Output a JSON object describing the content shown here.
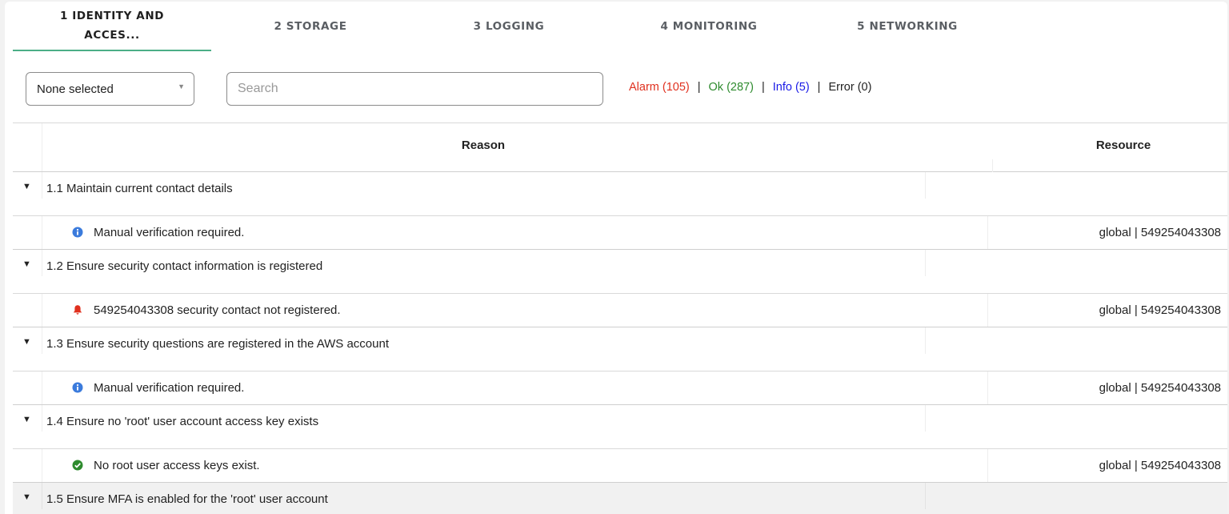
{
  "tabs": [
    {
      "label_line1": "1 IDENTITY AND",
      "label_line2": "ACCES..."
    },
    {
      "label": "2 STORAGE"
    },
    {
      "label": "3 LOGGING"
    },
    {
      "label": "4 MONITORING"
    },
    {
      "label": "5 NETWORKING"
    }
  ],
  "filter": {
    "selected": "None selected",
    "arrow": "▼"
  },
  "search": {
    "placeholder": "Search"
  },
  "counts": {
    "alarm": "Alarm (105)",
    "ok": "Ok (287)",
    "info": "Info (5)",
    "error": "Error (0)",
    "separator": "|"
  },
  "table": {
    "headers": {
      "reason": "Reason",
      "resource": "Resource"
    },
    "groups": [
      {
        "title": "1.1 Maintain current contact details",
        "row": {
          "status_icon": "info-circle-icon",
          "reason": "Manual verification required.",
          "resource": "global | 549254043308"
        }
      },
      {
        "title": "1.2 Ensure security contact information is registered",
        "row": {
          "status_icon": "alarm-bell-icon",
          "reason": "549254043308 security contact not registered.",
          "resource": "global | 549254043308"
        }
      },
      {
        "title": "1.3 Ensure security questions are registered in the AWS account",
        "row": {
          "status_icon": "info-circle-icon",
          "reason": "Manual verification required.",
          "resource": "global | 549254043308"
        }
      },
      {
        "title": "1.4 Ensure no 'root' user account access key exists",
        "row": {
          "status_icon": "ok-check-icon",
          "reason": "No root user access keys exist.",
          "resource": "global | 549254043308"
        }
      },
      {
        "title": "1.5 Ensure MFA is enabled for the 'root' user account"
      }
    ],
    "caret": "▼"
  },
  "colors": {
    "accent_tab_underline": "#4cae87",
    "alarm": "#e0301e",
    "ok": "#2e8b2e",
    "info": "#1a1ae6",
    "info_icon": "#3b7bdc"
  }
}
